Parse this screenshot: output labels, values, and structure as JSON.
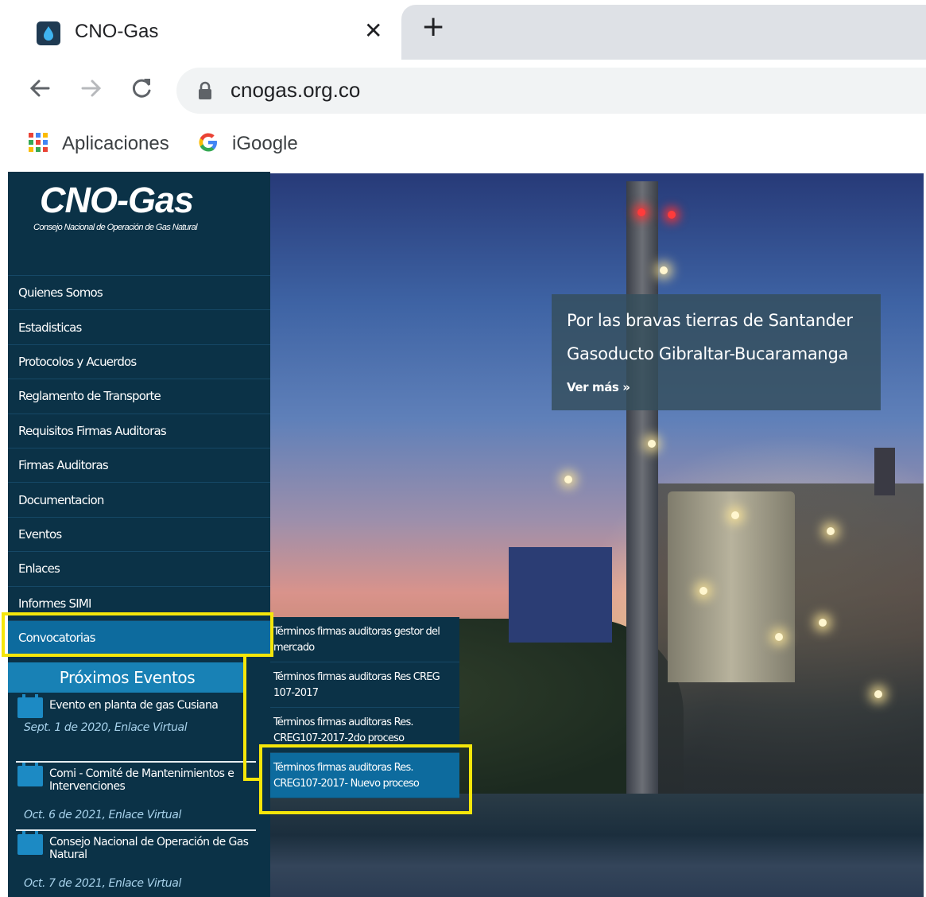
{
  "browser": {
    "tab_title": "CNO-Gas",
    "close_glyph": "✕",
    "newtab_glyph": "+",
    "url": "cnogas.org.co",
    "bookmarks": [
      {
        "label": "Aplicaciones",
        "icon": "apps-grid-icon"
      },
      {
        "label": "iGoogle",
        "icon": "google-g-icon"
      }
    ]
  },
  "site": {
    "logo": "CNO-Gas",
    "tagline": "Consejo Nacional de Operación de Gas Natural",
    "menu": [
      "Quienes Somos",
      "Estadisticas",
      "Protocolos y Acuerdos",
      "Reglamento de Transporte",
      "Requisitos Firmas Auditoras",
      "Firmas Auditoras",
      "Documentacion",
      "Eventos",
      "Enlaces",
      "Informes SIMI",
      "Convocatorias"
    ],
    "active_menu": "Convocatorias",
    "submenu": [
      "Términos firmas auditoras gestor del mercado",
      "Términos firmas auditoras Res CREG 107-2017",
      "Términos firmas auditoras Res. CREG107-2017-2do proceso",
      "Términos firmas auditoras Res. CREG107-2017- Nuevo proceso"
    ],
    "events_title": "Próximos Eventos",
    "events": [
      {
        "title": "Evento en planta de gas Cusiana",
        "date": "Sept. 1 de 2020, Enlace Virtual"
      },
      {
        "title": "Comi - Comité de Mantenimientos e Intervenciones",
        "date": "Oct. 6 de 2021, Enlace Virtual"
      },
      {
        "title": "Consejo Nacional de Operación de Gas Natural",
        "date": "Oct. 7 de 2021, Enlace Virtual"
      }
    ],
    "hero_caption": {
      "line1": "Por las bravas tierras de Santander",
      "line2": "Gasoducto Gibraltar-Bucaramanga",
      "more": "Ver más »"
    }
  },
  "colors": {
    "sidebar": "#0b3247",
    "active": "#0d6b9e",
    "highlight": "#f5e60a"
  }
}
